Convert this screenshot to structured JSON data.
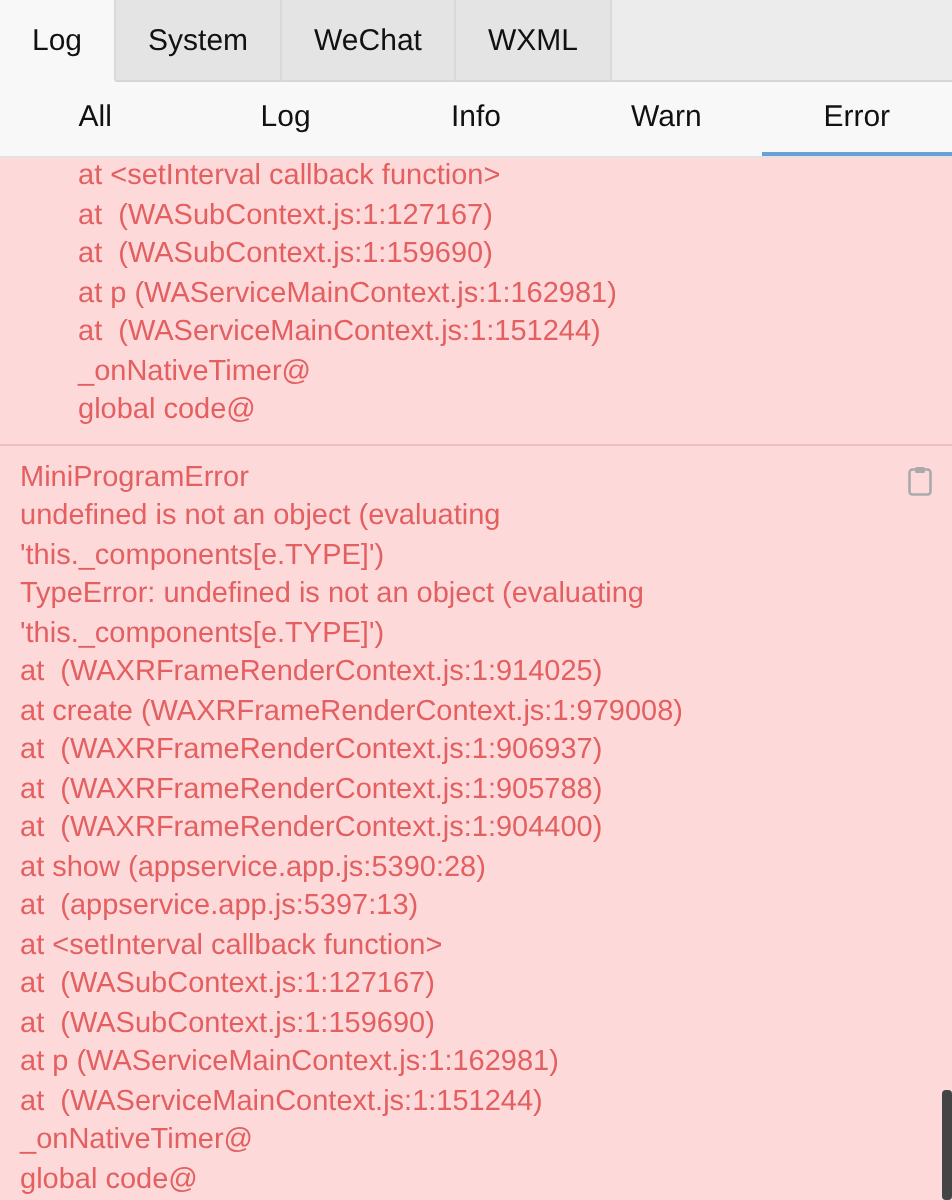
{
  "tabs": [
    {
      "label": "Log",
      "selected": true
    },
    {
      "label": "System",
      "selected": false
    },
    {
      "label": "WeChat",
      "selected": false
    },
    {
      "label": "WXML",
      "selected": false
    }
  ],
  "filters": [
    {
      "label": "All",
      "selected": false
    },
    {
      "label": "Log",
      "selected": false
    },
    {
      "label": "Info",
      "selected": false
    },
    {
      "label": "Warn",
      "selected": false
    },
    {
      "label": "Error",
      "selected": true
    }
  ],
  "entries": [
    {
      "kind": "continuation",
      "lines": [
        "at <setInterval callback function>",
        "at  (WASubContext.js:1:127167)",
        "at  (WASubContext.js:1:159690)",
        "at p (WAServiceMainContext.js:1:162981)",
        "at  (WAServiceMainContext.js:1:151244)",
        "_onNativeTimer@",
        "global code@"
      ]
    },
    {
      "kind": "entry",
      "lines": [
        "MiniProgramError",
        "undefined is not an object (evaluating",
        "'this._components[e.TYPE]')",
        "TypeError: undefined is not an object (evaluating",
        "'this._components[e.TYPE]')",
        "at  (WAXRFrameRenderContext.js:1:914025)",
        "at create (WAXRFrameRenderContext.js:1:979008)",
        "at  (WAXRFrameRenderContext.js:1:906937)",
        "at  (WAXRFrameRenderContext.js:1:905788)",
        "at  (WAXRFrameRenderContext.js:1:904400)",
        "at show (appservice.app.js:5390:28)",
        "at  (appservice.app.js:5397:13)",
        "at <setInterval callback function>",
        "at  (WASubContext.js:1:127167)",
        "at  (WASubContext.js:1:159690)",
        "at p (WAServiceMainContext.js:1:162981)",
        "at  (WAServiceMainContext.js:1:151244)",
        "_onNativeTimer@",
        "global code@"
      ]
    }
  ]
}
